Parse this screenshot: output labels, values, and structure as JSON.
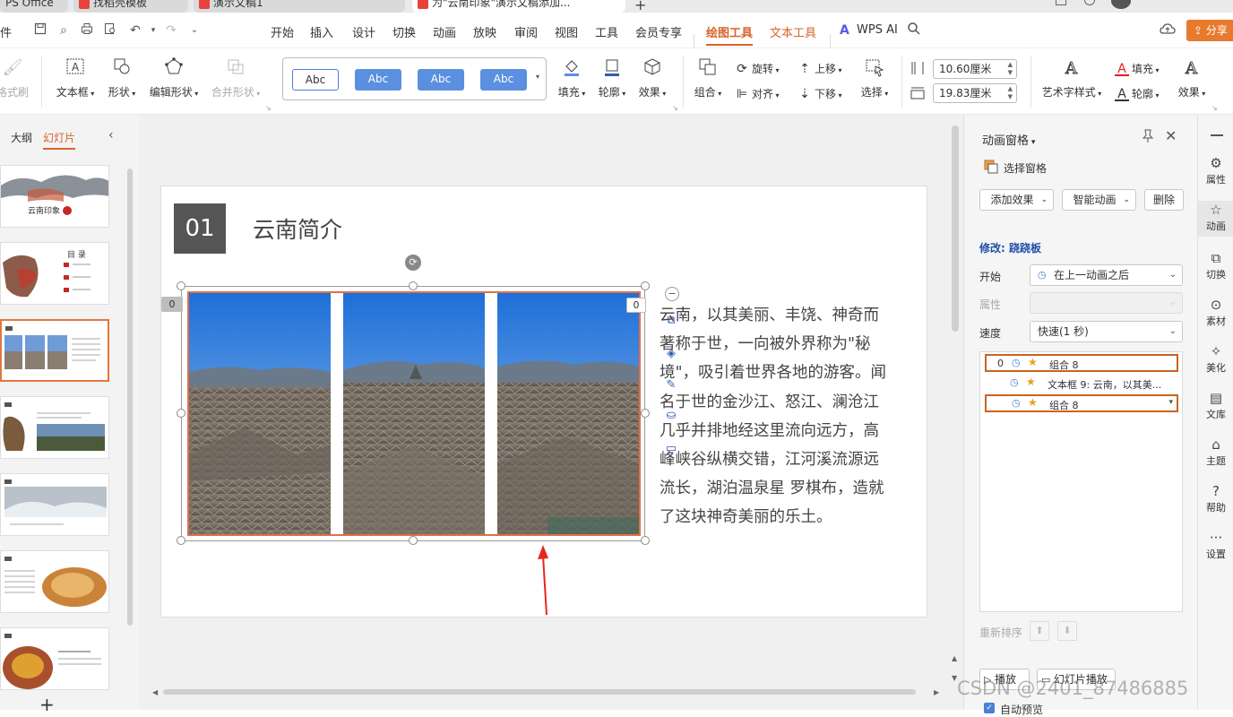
{
  "tabs": [
    {
      "label": "PS Office"
    },
    {
      "label": "找稻壳模板"
    },
    {
      "label": "演示文稿1"
    },
    {
      "label": "为\"云南印象\"演示文稿添加..."
    }
  ],
  "menu": {
    "file": "件",
    "items": [
      "开始",
      "插入",
      "设计",
      "切换",
      "动画",
      "放映",
      "审阅",
      "视图",
      "工具",
      "会员专享"
    ],
    "drawing_tools": "绘图工具",
    "text_tools": "文本工具",
    "wps_ai": "WPS AI",
    "share": "分享"
  },
  "ribbon": {
    "format_painter": "格式刷",
    "textbox": "文本框",
    "shape": "形状",
    "edit_shape": "编辑形状",
    "merge_shape": "合并形状",
    "style_samples": [
      "Abc",
      "Abc",
      "Abc",
      "Abc"
    ],
    "fill": "填充",
    "outline": "轮廓",
    "effect": "效果",
    "group": "组合",
    "rotate": "旋转",
    "align": "对齐",
    "bring_forward": "上移",
    "send_backward": "下移",
    "select": "选择",
    "width_value": "10.60厘米",
    "height_value": "19.83厘米",
    "art_text_style": "艺术字样式",
    "text_fill": "填充",
    "text_outline": "轮廓",
    "text_effect": "效果"
  },
  "left_panel": {
    "tab_outline": "大纲",
    "tab_slides": "幻灯片",
    "slide1_title": "云南印象",
    "slide2_title": "目 录"
  },
  "slide": {
    "number": "01",
    "title": "云南简介",
    "body": "云南，以其美丽、丰饶、神奇而著称于世，一向被外界称为\"秘境\"，吸引着世界各地的游客。闻名于世的金沙江、怒江、澜沧江几乎并排地经这里流向远方，高峰峡谷纵横交错，江河溪流源远流长，湖泊温泉星 罗棋布，造就了这块神奇美丽的乐土。",
    "anim_tag_left": "0",
    "anim_tag_right": "0"
  },
  "anim_pane": {
    "title": "动画窗格",
    "selection_pane": "选择窗格",
    "add_effect": "添加效果",
    "smart_animation": "智能动画",
    "delete": "删除",
    "modify_label": "修改: 跷跷板",
    "start_label": "开始",
    "start_value": "在上一动画之后",
    "property_label": "属性",
    "speed_label": "速度",
    "speed_value": "快速(1 秒)",
    "items": [
      {
        "index": "0",
        "label": "组合 8"
      },
      {
        "index": "",
        "label": "文本框 9: 云南，以其美..."
      },
      {
        "index": "",
        "label": "组合 8"
      }
    ],
    "reorder": "重新排序",
    "play": "播放",
    "slideshow": "幻灯片播放",
    "auto_preview": "自动预览"
  },
  "sidebar": {
    "items": [
      "属性",
      "动画",
      "切换",
      "素材",
      "美化",
      "文库",
      "主题",
      "帮助",
      "设置"
    ]
  },
  "watermark": "CSDN @2401_87486885",
  "colors": {
    "accent_orange": "#d9632b",
    "selection_border": "#e0704a",
    "red_arrow": "#e8261c",
    "item_highlight": "#c9641e"
  }
}
